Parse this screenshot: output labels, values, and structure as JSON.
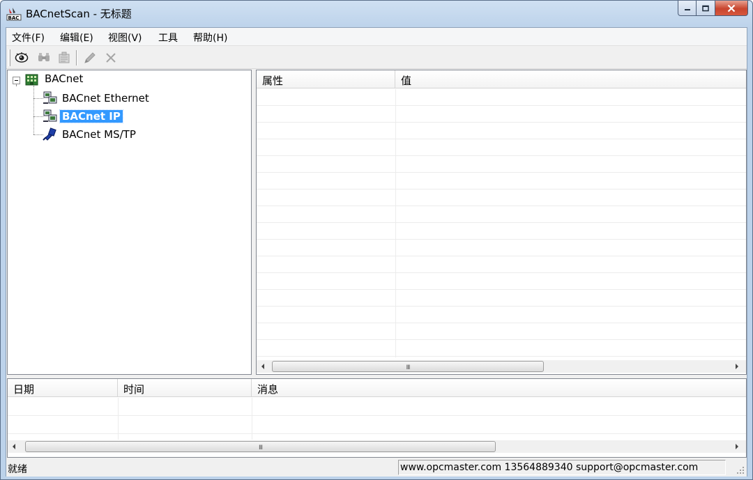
{
  "window": {
    "title": "BACnetScan - 无标题",
    "icon": "bac-app-icon",
    "caption": {
      "minimize": "minimize-icon",
      "maximize": "maximize-icon",
      "close": "close-icon"
    }
  },
  "menu": {
    "items": [
      {
        "label": "文件(F)"
      },
      {
        "label": "编辑(E)"
      },
      {
        "label": "视图(V)"
      },
      {
        "label": "工具"
      },
      {
        "label": "帮助(H)"
      }
    ]
  },
  "toolbar": {
    "buttons": [
      {
        "icon": "eye-icon",
        "enabled": true
      },
      {
        "icon": "binoculars-icon",
        "enabled": false
      },
      {
        "icon": "properties-icon",
        "enabled": false
      },
      {
        "icon": "pencil-icon",
        "enabled": false
      },
      {
        "icon": "delete-x-icon",
        "enabled": false
      }
    ]
  },
  "tree": {
    "root": {
      "label": "BACnet",
      "expanded": true,
      "icon": "building-icon"
    },
    "children": [
      {
        "label": "BACnet Ethernet",
        "icon": "network-icon",
        "selected": false
      },
      {
        "label": "BACnet IP",
        "icon": "network-icon",
        "selected": true
      },
      {
        "label": "BACnet MS/TP",
        "icon": "serial-port-icon",
        "selected": false
      }
    ]
  },
  "property_list": {
    "columns": [
      "属性",
      "值"
    ],
    "rows": []
  },
  "log": {
    "columns": [
      "日期",
      "时间",
      "消息"
    ],
    "rows": []
  },
  "status": {
    "left": "就绪",
    "right": "www.opcmaster.com 13564889340 support@opcmaster.com"
  },
  "colors": {
    "selection": "#3399ff",
    "close_button": "#c8452e",
    "frame": "#bcd2ea"
  }
}
